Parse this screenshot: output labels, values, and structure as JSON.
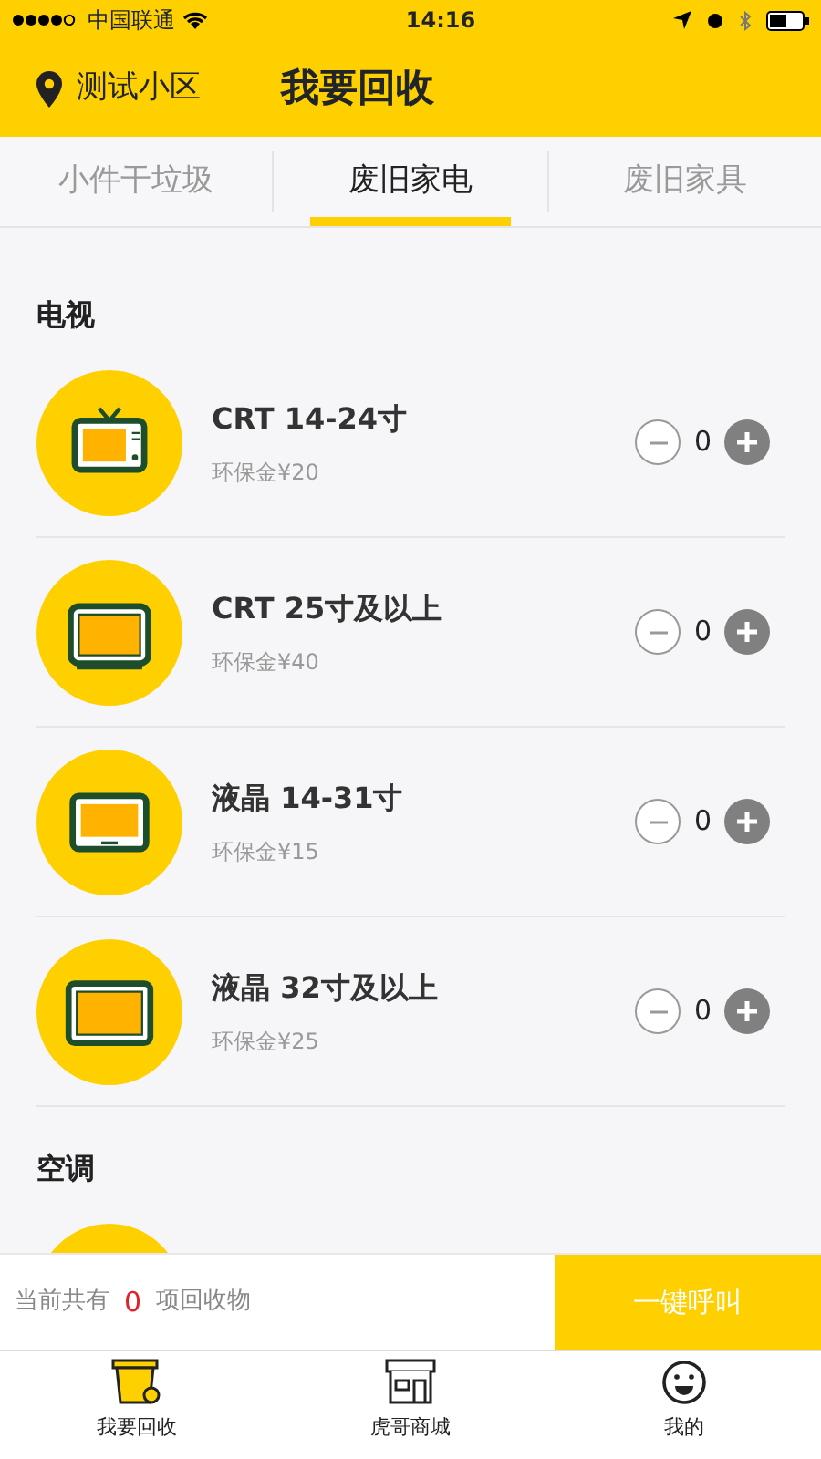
{
  "status_bar": {
    "carrier": "中国联通",
    "time": "14:16"
  },
  "header": {
    "location": "测试小区",
    "title": "我要回收"
  },
  "tabs": [
    {
      "label": "小件干垃圾",
      "selected": false
    },
    {
      "label": "废旧家电",
      "selected": true
    },
    {
      "label": "废旧家具",
      "selected": false
    }
  ],
  "sections": [
    {
      "title": "电视",
      "items": [
        {
          "kind": "crt",
          "name": "CRT 14-24寸",
          "deposit": "环保金¥20",
          "count": "0"
        },
        {
          "kind": "crt-large",
          "name": "CRT 25寸及以上",
          "deposit": "环保金¥40",
          "count": "0"
        },
        {
          "kind": "lcd",
          "name": "液晶 14-31寸",
          "deposit": "环保金¥15",
          "count": "0"
        },
        {
          "kind": "lcd-large",
          "name": "液晶 32寸及以上",
          "deposit": "环保金¥25",
          "count": "0"
        }
      ]
    },
    {
      "title": "空调",
      "items": [
        {
          "kind": "ac"
        }
      ]
    }
  ],
  "summary": {
    "prefix": "当前共有",
    "count": "0",
    "suffix": "项回收物",
    "button": "一键呼叫"
  },
  "bottom_nav": [
    {
      "kind": "bin",
      "label": "我要回收",
      "selected": true
    },
    {
      "kind": "shop",
      "label": "虎哥商城",
      "selected": false
    },
    {
      "kind": "face",
      "label": "我的",
      "selected": false
    }
  ]
}
